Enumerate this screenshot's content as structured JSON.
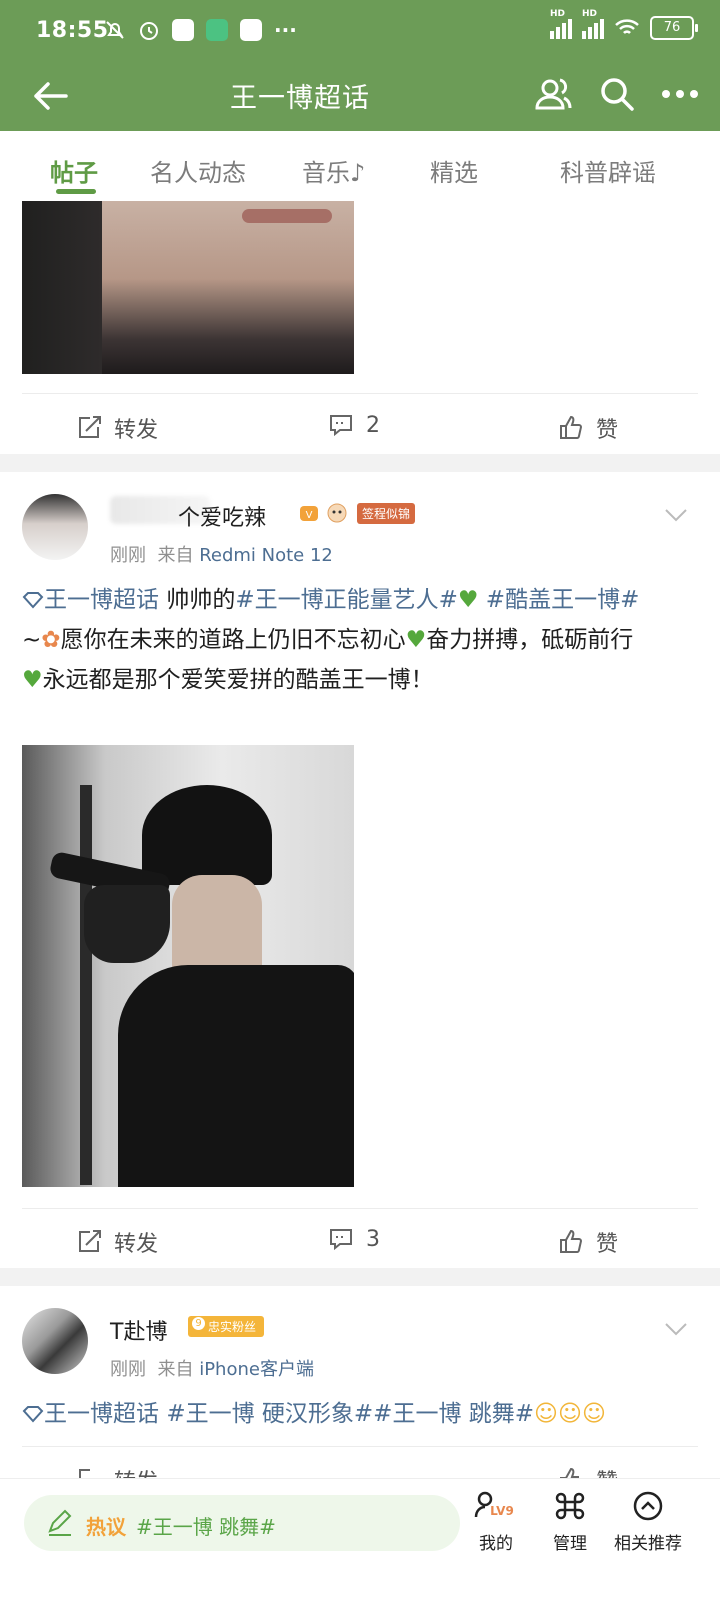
{
  "status_bar": {
    "time": "18:55",
    "battery": "76",
    "network_label": "HD"
  },
  "header": {
    "title": "王一博超话",
    "icons": [
      "back-arrow-icon",
      "people-icon",
      "search-icon",
      "more-icon"
    ]
  },
  "tabs": [
    {
      "label": "帖子",
      "active": true
    },
    {
      "label": "名人动态",
      "active": false
    },
    {
      "label": "音乐♪",
      "active": false
    },
    {
      "label": "精选",
      "active": false
    },
    {
      "label": "科普辟谣",
      "active": false
    }
  ],
  "post1": {
    "repost_label": "转发",
    "comment_count": "2",
    "like_label": "赞"
  },
  "post2": {
    "username": "个爱吃辣",
    "badge": "签程似锦",
    "time": "刚刚",
    "from_prefix": "来自",
    "source": "Redmi Note 12",
    "text": {
      "topic": "王一博超话",
      "plain1": "帅帅的",
      "tag1": "#王一博正能量艺人#",
      "tag2": "#酷盖王一博#",
      "line2_prefix": "~",
      "line2": "愿你在未来的道路上仍旧不忘初心",
      "line2b": "奋力拼搏，砥砺前行",
      "line2c": "永远都是那个爱笑爱拼的酷盖王一博！"
    },
    "repost_label": "转发",
    "comment_count": "3",
    "like_label": "赞"
  },
  "post3": {
    "username": "T赴博",
    "badge": "忠实粉丝",
    "badge_level": "9",
    "time": "刚刚",
    "from_prefix": "来自",
    "source": "iPhone客户端",
    "text": {
      "topic": "王一博超话",
      "tags": "#王一博 硬汉形象##王一博 跳舞#"
    },
    "repost_label": "转发",
    "like_label": "赞"
  },
  "bottom_bar": {
    "hot_label": "热议",
    "hot_tag": "#王一博 跳舞#",
    "items": [
      {
        "label": "我的",
        "icon": "profile-level-icon",
        "level": "LV9"
      },
      {
        "label": "管理",
        "icon": "command-icon"
      },
      {
        "label": "相关推荐",
        "icon": "chevron-up-circle-icon"
      }
    ]
  },
  "colors": {
    "header_green": "#6c9c57",
    "active_tab": "#5f9b45",
    "topic_link": "#4d6e92",
    "hot_orange": "#f2a23a"
  }
}
